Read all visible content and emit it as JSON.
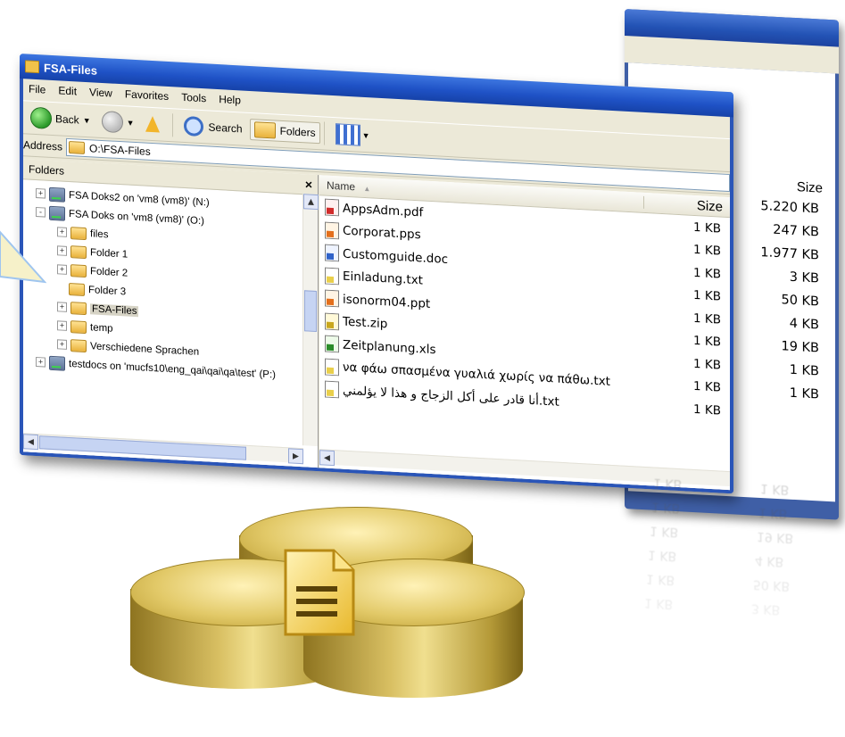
{
  "window": {
    "title": "FSA-Files",
    "menu": [
      "File",
      "Edit",
      "View",
      "Favorites",
      "Tools",
      "Help"
    ],
    "toolbar": {
      "back_label": "Back",
      "search_label": "Search",
      "folders_label": "Folders"
    },
    "address": {
      "label": "Address",
      "value": "O:\\FSA-Files"
    }
  },
  "folders_pane": {
    "header": "Folders",
    "close_glyph": "×",
    "tree": [
      {
        "indent": 0,
        "toggle": "+",
        "type": "drive",
        "label": "FSA Doks2 on 'vm8 (vm8)' (N:)"
      },
      {
        "indent": 0,
        "toggle": "-",
        "type": "drive",
        "label": "FSA Doks on 'vm8 (vm8)' (O:)"
      },
      {
        "indent": 1,
        "toggle": "+",
        "type": "folder",
        "label": "files"
      },
      {
        "indent": 1,
        "toggle": "+",
        "type": "folder",
        "label": "Folder 1"
      },
      {
        "indent": 1,
        "toggle": "+",
        "type": "folder",
        "label": "Folder 2"
      },
      {
        "indent": 1,
        "toggle": "",
        "type": "folder",
        "label": "Folder 3"
      },
      {
        "indent": 1,
        "toggle": "+",
        "type": "folder",
        "label": "FSA-Files",
        "selected": true
      },
      {
        "indent": 1,
        "toggle": "+",
        "type": "folder",
        "label": "temp"
      },
      {
        "indent": 1,
        "toggle": "+",
        "type": "folder",
        "label": "Verschiedene Sprachen"
      },
      {
        "indent": 0,
        "toggle": "+",
        "type": "drive",
        "label": "testdocs on 'mucfs10\\eng_qai\\qai\\qa\\test' (P:)"
      }
    ]
  },
  "files_pane": {
    "columns": {
      "name": "Name",
      "size": "Size"
    },
    "rows": [
      {
        "name": "AppsAdm.pdf",
        "kind": "pdf",
        "size": "1 KB",
        "size2": "5.220 KB"
      },
      {
        "name": "Corporat.pps",
        "kind": "pps",
        "size": "1 KB",
        "size2": "247 KB"
      },
      {
        "name": "Customguide.doc",
        "kind": "doc",
        "size": "1 KB",
        "size2": "1.977 KB"
      },
      {
        "name": "Einladung.txt",
        "kind": "txt",
        "size": "1 KB",
        "size2": "3 KB"
      },
      {
        "name": "isonorm04.ppt",
        "kind": "pps",
        "size": "1 KB",
        "size2": "50 KB"
      },
      {
        "name": "Test.zip",
        "kind": "zip",
        "size": "1 KB",
        "size2": "4 KB"
      },
      {
        "name": "Zeitplanung.xls",
        "kind": "xls",
        "size": "1 KB",
        "size2": "19 KB"
      },
      {
        "name": "να φάω σπασμένα γυαλιά χωρίς να πάθω.txt",
        "kind": "txt",
        "size": "1 KB",
        "size2": "1 KB"
      },
      {
        "name": "أنا قادر على أكل الزجاج و هذا لا يؤلمني.txt",
        "kind": "txt",
        "size": "1 KB",
        "size2": "1 KB"
      }
    ]
  },
  "back_window": {
    "size_header": "Size"
  },
  "colors": {
    "titlebar": "#1f52c6",
    "chrome": "#ece9d8",
    "database_gold": "#d9c063"
  }
}
